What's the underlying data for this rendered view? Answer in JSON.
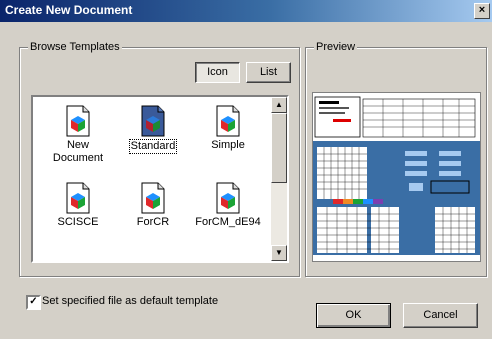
{
  "window": {
    "title": "Create New Document",
    "close_glyph": "×"
  },
  "browse": {
    "legend": "Browse Templates",
    "icon_button": "Icon",
    "list_button": "List",
    "items": [
      {
        "label": "New Document",
        "selected": false
      },
      {
        "label": "Standard",
        "selected": true
      },
      {
        "label": "Simple",
        "selected": false
      },
      {
        "label": "SCISCE",
        "selected": false
      },
      {
        "label": "ForCR",
        "selected": false
      },
      {
        "label": "ForCM_dE94",
        "selected": false
      }
    ],
    "scroll_up": "▲",
    "scroll_down": "▼"
  },
  "preview": {
    "legend": "Preview"
  },
  "default_checkbox": {
    "checked": true,
    "mark": "✓",
    "label": "Set specified file as default template"
  },
  "ok_button": "OK",
  "cancel_button": "Cancel",
  "colors": {
    "title_start": "#0a246a",
    "title_end": "#a6caf0",
    "face": "#d4d0c8",
    "preview_blue": "#3a6ea5"
  }
}
